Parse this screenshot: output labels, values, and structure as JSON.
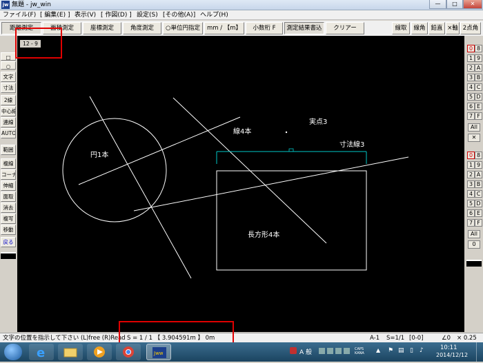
{
  "window": {
    "title": "無題 - jw_win",
    "app_icon": "jw",
    "controls": [
      "—",
      "□",
      "✕"
    ]
  },
  "menu": [
    "ファイル(F)",
    "[ 編集(E) ]",
    "表示(V)",
    "[ 作図(D) ]",
    "設定(S)",
    "[その他(A)]",
    "ヘルプ(H)"
  ],
  "toolbar": {
    "buttons": [
      "距離測定",
      "面積測定",
      "座標測定",
      "角度測定",
      "○単位円指定",
      "mm / 【m】",
      "小数桁 F",
      "測定結果書込",
      "クリアー"
    ],
    "right_buttons": [
      "線取",
      "線角",
      "鉛直",
      "×軸",
      "2点角"
    ]
  },
  "left_tools": [
    "□",
    "○",
    "文字",
    "寸法",
    "2線",
    "中心線",
    "連線",
    "AUTO",
    "範囲",
    "複線",
    "コーナー",
    "伸縮",
    "面取",
    "消去",
    "複写",
    "移動",
    "戻る"
  ],
  "right_layers": {
    "col1": [
      "0",
      "1",
      "2",
      "3",
      "4",
      "5",
      "6",
      "7"
    ],
    "col2": [
      "8",
      "9",
      "A",
      "B",
      "C",
      "D",
      "E",
      "F"
    ],
    "all_label": "All",
    "x_label": "✕",
    "group_col1": [
      "0",
      "1",
      "2",
      "3",
      "4",
      "5",
      "6",
      "7"
    ],
    "group_col2": [
      "8",
      "9",
      "A",
      "B",
      "C",
      "D",
      "E",
      "F"
    ],
    "bottom_all": "All",
    "bottom_value": "0"
  },
  "canvas": {
    "scale_label": "12 - 9",
    "labels": {
      "circle": "円1本",
      "lines": "線4本",
      "points": "実点3",
      "dims": "寸法線3",
      "rect": "長方形4本"
    }
  },
  "status": {
    "prompt": "文字の位置を指示して下さい (L)free (R)Read",
    "measure": "S = 1 / 1 【 3.904591m 】  0m",
    "paper": "A-1",
    "scale": "S=1/1",
    "layer": "[0-0]",
    "angle": "∠0",
    "zoom": "× 0.25"
  },
  "taskbar": {
    "ime": "A 般",
    "caps": "CAPS KANA",
    "time": "10:11",
    "date": "2014/12/12"
  }
}
